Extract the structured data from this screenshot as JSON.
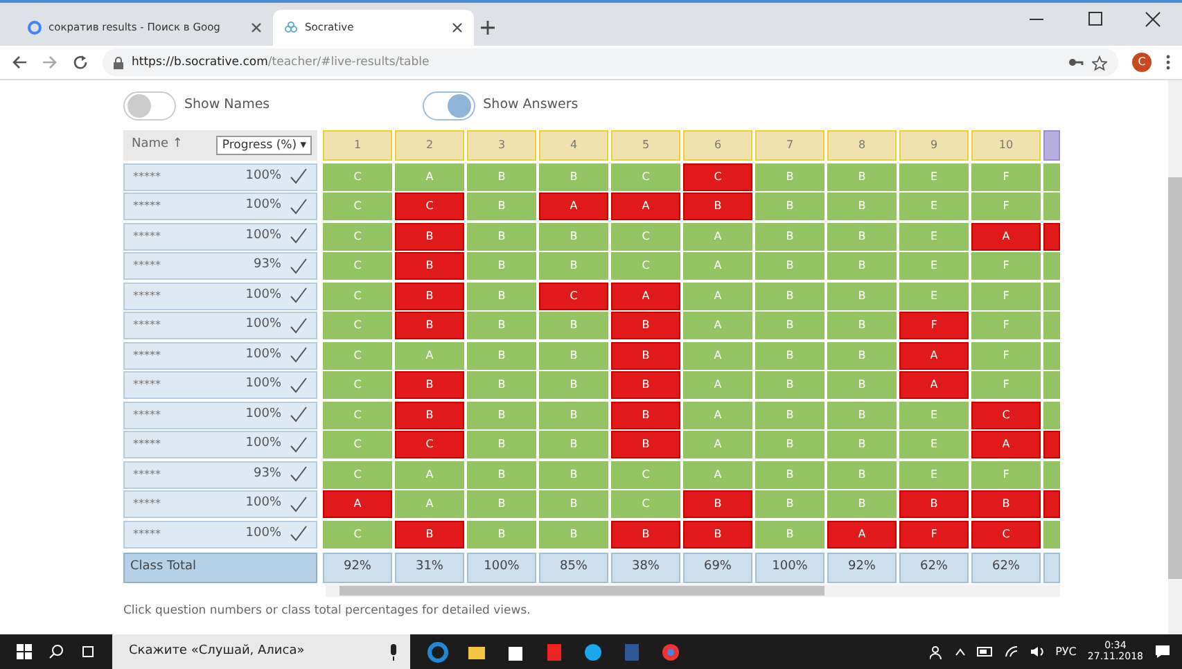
{
  "browser": {
    "tabs": [
      {
        "title": "сократив results - Поиск в Goog",
        "selected": false
      },
      {
        "title": "Socrative",
        "selected": true
      }
    ],
    "url_host": "https://b.socrative.com",
    "url_path": "/teacher/#live-results/table",
    "avatar": "C"
  },
  "toggles": [
    {
      "label": "Show Names",
      "on": false
    },
    {
      "label": "Show Answers",
      "on": true
    }
  ],
  "table": {
    "name_header": "Name ↑",
    "progress_header": "Progress (%) ▾",
    "questions": [
      "1",
      "2",
      "3",
      "4",
      "5",
      "6",
      "7",
      "8",
      "9",
      "10"
    ],
    "rows": [
      {
        "name": "*****",
        "progress": "100%",
        "answers": [
          {
            "text": "C",
            "correct": true
          },
          {
            "text": "A",
            "correct": true
          },
          {
            "text": "B",
            "correct": true
          },
          {
            "text": "B",
            "correct": true
          },
          {
            "text": "C",
            "correct": true
          },
          {
            "text": "C",
            "correct": false
          },
          {
            "text": "B",
            "correct": true
          },
          {
            "text": "B",
            "correct": true
          },
          {
            "text": "E",
            "correct": true
          },
          {
            "text": "F",
            "correct": true
          },
          {
            "correct": true
          }
        ]
      },
      {
        "name": "*****",
        "progress": "100%",
        "answers": [
          {
            "text": "C",
            "correct": true
          },
          {
            "text": "C",
            "correct": false
          },
          {
            "text": "B",
            "correct": true
          },
          {
            "text": "A",
            "correct": false
          },
          {
            "text": "A",
            "correct": false
          },
          {
            "text": "B",
            "correct": false
          },
          {
            "text": "B",
            "correct": true
          },
          {
            "text": "B",
            "correct": true
          },
          {
            "text": "E",
            "correct": true
          },
          {
            "text": "F",
            "correct": true
          },
          {
            "correct": true
          }
        ]
      },
      {
        "name": "*****",
        "progress": "100%",
        "answers": [
          {
            "text": "C",
            "correct": true
          },
          {
            "text": "B",
            "correct": false
          },
          {
            "text": "B",
            "correct": true
          },
          {
            "text": "B",
            "correct": true
          },
          {
            "text": "C",
            "correct": true
          },
          {
            "text": "A",
            "correct": true
          },
          {
            "text": "B",
            "correct": true
          },
          {
            "text": "B",
            "correct": true
          },
          {
            "text": "E",
            "correct": true
          },
          {
            "text": "A",
            "correct": false
          },
          {
            "correct": false
          }
        ]
      },
      {
        "name": "*****",
        "progress": "93%",
        "answers": [
          {
            "text": "C",
            "correct": true
          },
          {
            "text": "B",
            "correct": false
          },
          {
            "text": "B",
            "correct": true
          },
          {
            "text": "B",
            "correct": true
          },
          {
            "text": "C",
            "correct": true
          },
          {
            "text": "A",
            "correct": true
          },
          {
            "text": "B",
            "correct": true
          },
          {
            "text": "B",
            "correct": true
          },
          {
            "text": "E",
            "correct": true
          },
          {
            "text": "F",
            "correct": true
          },
          {
            "correct": true
          }
        ]
      },
      {
        "name": "*****",
        "progress": "100%",
        "answers": [
          {
            "text": "C",
            "correct": true
          },
          {
            "text": "B",
            "correct": false
          },
          {
            "text": "B",
            "correct": true
          },
          {
            "text": "C",
            "correct": false
          },
          {
            "text": "A",
            "correct": false
          },
          {
            "text": "A",
            "correct": true
          },
          {
            "text": "B",
            "correct": true
          },
          {
            "text": "B",
            "correct": true
          },
          {
            "text": "E",
            "correct": true
          },
          {
            "text": "F",
            "correct": true
          },
          {
            "correct": true
          }
        ]
      },
      {
        "name": "*****",
        "progress": "100%",
        "answers": [
          {
            "text": "C",
            "correct": true
          },
          {
            "text": "B",
            "correct": false
          },
          {
            "text": "B",
            "correct": true
          },
          {
            "text": "B",
            "correct": true
          },
          {
            "text": "B",
            "correct": false
          },
          {
            "text": "A",
            "correct": true
          },
          {
            "text": "B",
            "correct": true
          },
          {
            "text": "B",
            "correct": true
          },
          {
            "text": "F",
            "correct": false
          },
          {
            "text": "F",
            "correct": true
          },
          {
            "correct": true
          }
        ]
      },
      {
        "name": "*****",
        "progress": "100%",
        "answers": [
          {
            "text": "C",
            "correct": true
          },
          {
            "text": "A",
            "correct": true
          },
          {
            "text": "B",
            "correct": true
          },
          {
            "text": "B",
            "correct": true
          },
          {
            "text": "B",
            "correct": false
          },
          {
            "text": "A",
            "correct": true
          },
          {
            "text": "B",
            "correct": true
          },
          {
            "text": "B",
            "correct": true
          },
          {
            "text": "A",
            "correct": false
          },
          {
            "text": "F",
            "correct": true
          },
          {
            "correct": true
          }
        ]
      },
      {
        "name": "*****",
        "progress": "100%",
        "answers": [
          {
            "text": "C",
            "correct": true
          },
          {
            "text": "B",
            "correct": false
          },
          {
            "text": "B",
            "correct": true
          },
          {
            "text": "B",
            "correct": true
          },
          {
            "text": "B",
            "correct": false
          },
          {
            "text": "A",
            "correct": true
          },
          {
            "text": "B",
            "correct": true
          },
          {
            "text": "B",
            "correct": true
          },
          {
            "text": "A",
            "correct": false
          },
          {
            "text": "F",
            "correct": true
          },
          {
            "correct": true
          }
        ]
      },
      {
        "name": "*****",
        "progress": "100%",
        "answers": [
          {
            "text": "C",
            "correct": true
          },
          {
            "text": "B",
            "correct": false
          },
          {
            "text": "B",
            "correct": true
          },
          {
            "text": "B",
            "correct": true
          },
          {
            "text": "B",
            "correct": false
          },
          {
            "text": "A",
            "correct": true
          },
          {
            "text": "B",
            "correct": true
          },
          {
            "text": "B",
            "correct": true
          },
          {
            "text": "E",
            "correct": true
          },
          {
            "text": "C",
            "correct": false
          },
          {
            "correct": true
          }
        ]
      },
      {
        "name": "*****",
        "progress": "100%",
        "answers": [
          {
            "text": "C",
            "correct": true
          },
          {
            "text": "C",
            "correct": false
          },
          {
            "text": "B",
            "correct": true
          },
          {
            "text": "B",
            "correct": true
          },
          {
            "text": "B",
            "correct": false
          },
          {
            "text": "A",
            "correct": true
          },
          {
            "text": "B",
            "correct": true
          },
          {
            "text": "B",
            "correct": true
          },
          {
            "text": "E",
            "correct": true
          },
          {
            "text": "A",
            "correct": false
          },
          {
            "correct": false
          }
        ]
      },
      {
        "name": "*****",
        "progress": "93%",
        "answers": [
          {
            "text": "C",
            "correct": true
          },
          {
            "text": "A",
            "correct": true
          },
          {
            "text": "B",
            "correct": true
          },
          {
            "text": "B",
            "correct": true
          },
          {
            "text": "C",
            "correct": true
          },
          {
            "text": "A",
            "correct": true
          },
          {
            "text": "B",
            "correct": true
          },
          {
            "text": "B",
            "correct": true
          },
          {
            "text": "E",
            "correct": true
          },
          {
            "text": "F",
            "correct": true
          },
          {
            "correct": true
          }
        ]
      },
      {
        "name": "*****",
        "progress": "100%",
        "answers": [
          {
            "text": "A",
            "correct": false
          },
          {
            "text": "A",
            "correct": true
          },
          {
            "text": "B",
            "correct": true
          },
          {
            "text": "B",
            "correct": true
          },
          {
            "text": "C",
            "correct": true
          },
          {
            "text": "B",
            "correct": false
          },
          {
            "text": "B",
            "correct": true
          },
          {
            "text": "B",
            "correct": true
          },
          {
            "text": "B",
            "correct": false
          },
          {
            "text": "B",
            "correct": false
          },
          {
            "correct": false
          }
        ]
      },
      {
        "name": "*****",
        "progress": "100%",
        "answers": [
          {
            "text": "C",
            "correct": true
          },
          {
            "text": "B",
            "correct": false
          },
          {
            "text": "B",
            "correct": true
          },
          {
            "text": "B",
            "correct": true
          },
          {
            "text": "B",
            "correct": false
          },
          {
            "text": "B",
            "correct": false
          },
          {
            "text": "B",
            "correct": true
          },
          {
            "text": "A",
            "correct": false
          },
          {
            "text": "F",
            "correct": false
          },
          {
            "text": "C",
            "correct": false
          },
          {
            "correct": true
          }
        ]
      }
    ],
    "total_label": "Class Total",
    "totals": [
      "92%",
      "31%",
      "100%",
      "85%",
      "38%",
      "69%",
      "100%",
      "92%",
      "62%",
      "62%"
    ]
  },
  "hint": "Click question numbers or class total percentages for detailed views.",
  "taskbar": {
    "search": "Скажите «Слушай, Алиса»",
    "language": "РУС",
    "time": "0:34",
    "date": "27.11.2018"
  }
}
